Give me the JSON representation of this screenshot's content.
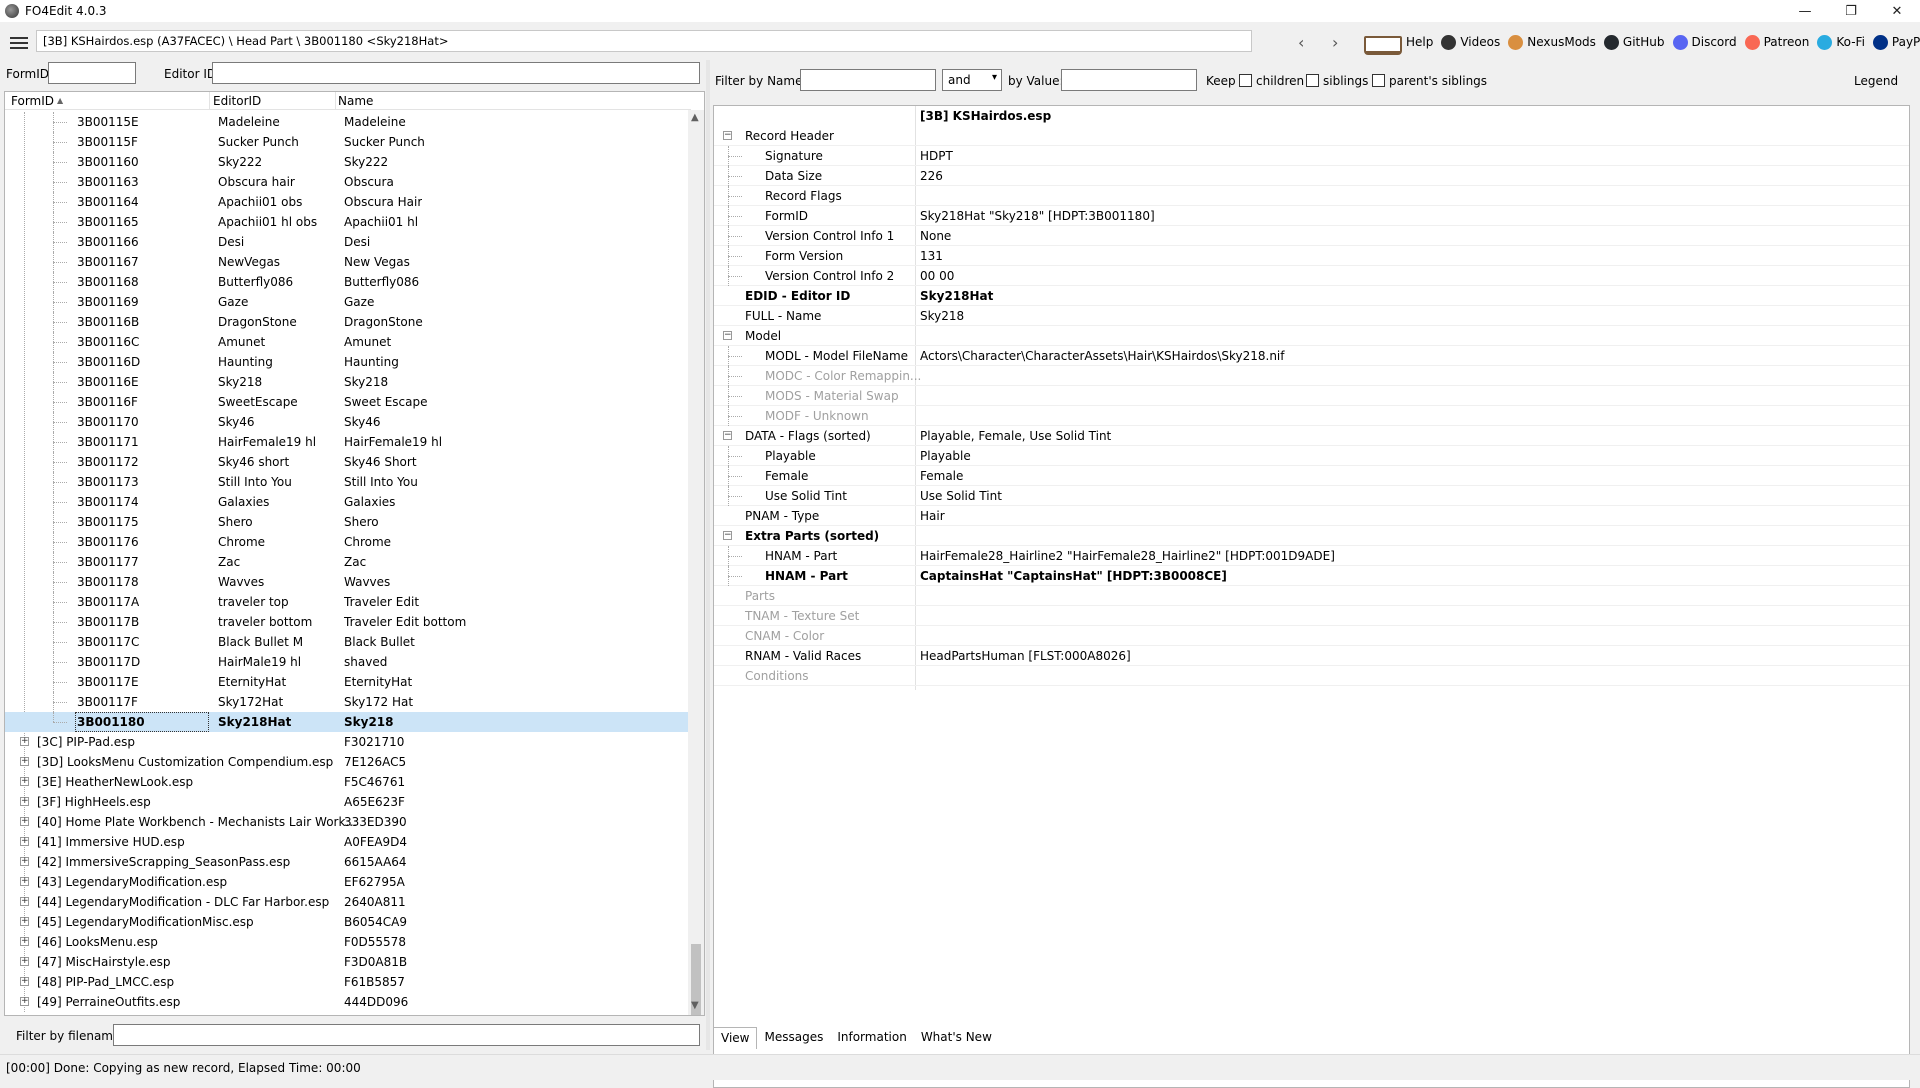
{
  "window": {
    "title": "FO4Edit 4.0.3",
    "controls": [
      "—",
      "❐",
      "✕"
    ]
  },
  "toolbar": {
    "path": "[3B] KSHairdos.esp (A37FACEC) \\ Head Part \\ 3B001180 <Sky218Hat>",
    "back": "‹",
    "forward": "›",
    "links": [
      {
        "label": "Help",
        "icon": "book-icon",
        "color": "#7a5a3a"
      },
      {
        "label": "Videos",
        "icon": "videos-icon",
        "color": "#333333"
      },
      {
        "label": "NexusMods",
        "icon": "nexusmods-icon",
        "color": "#d98f40"
      },
      {
        "label": "GitHub",
        "icon": "github-icon",
        "color": "#24292e"
      },
      {
        "label": "Discord",
        "icon": "discord-icon",
        "color": "#5865f2"
      },
      {
        "label": "Patreon",
        "icon": "patreon-icon",
        "color": "#f96854"
      },
      {
        "label": "Ko-Fi",
        "icon": "kofi-icon",
        "color": "#29abe0"
      },
      {
        "label": "PayPal",
        "icon": "paypal-icon",
        "color": "#003087"
      }
    ]
  },
  "left_filter": {
    "formid_label": "FormID",
    "editorid_label": "Editor ID",
    "formid_value": "",
    "editorid_value": ""
  },
  "tree": {
    "columns": [
      "FormID",
      "EditorID",
      "Name"
    ],
    "sort_indicator": "▲",
    "records": [
      {
        "formid": "3B00115E",
        "editorid": "Madeleine",
        "name": "Madeleine"
      },
      {
        "formid": "3B00115F",
        "editorid": "Sucker Punch",
        "name": "Sucker Punch"
      },
      {
        "formid": "3B001160",
        "editorid": "Sky222",
        "name": "Sky222"
      },
      {
        "formid": "3B001163",
        "editorid": "Obscura hair",
        "name": "Obscura"
      },
      {
        "formid": "3B001164",
        "editorid": "Apachii01 obs",
        "name": "Obscura Hair"
      },
      {
        "formid": "3B001165",
        "editorid": "Apachii01 hl obs",
        "name": "Apachii01 hl"
      },
      {
        "formid": "3B001166",
        "editorid": "Desi",
        "name": "Desi"
      },
      {
        "formid": "3B001167",
        "editorid": "NewVegas",
        "name": "New Vegas"
      },
      {
        "formid": "3B001168",
        "editorid": "Butterfly086",
        "name": "Butterfly086"
      },
      {
        "formid": "3B001169",
        "editorid": "Gaze",
        "name": "Gaze"
      },
      {
        "formid": "3B00116B",
        "editorid": "DragonStone",
        "name": "DragonStone"
      },
      {
        "formid": "3B00116C",
        "editorid": "Amunet",
        "name": "Amunet"
      },
      {
        "formid": "3B00116D",
        "editorid": "Haunting",
        "name": "Haunting"
      },
      {
        "formid": "3B00116E",
        "editorid": "Sky218",
        "name": "Sky218"
      },
      {
        "formid": "3B00116F",
        "editorid": "SweetEscape",
        "name": "Sweet Escape"
      },
      {
        "formid": "3B001170",
        "editorid": "Sky46",
        "name": "Sky46"
      },
      {
        "formid": "3B001171",
        "editorid": "HairFemale19 hl",
        "name": "HairFemale19 hl"
      },
      {
        "formid": "3B001172",
        "editorid": "Sky46 short",
        "name": "Sky46 Short"
      },
      {
        "formid": "3B001173",
        "editorid": "Still Into You",
        "name": "Still Into You"
      },
      {
        "formid": "3B001174",
        "editorid": "Galaxies",
        "name": "Galaxies"
      },
      {
        "formid": "3B001175",
        "editorid": "Shero",
        "name": "Shero"
      },
      {
        "formid": "3B001176",
        "editorid": "Chrome",
        "name": "Chrome"
      },
      {
        "formid": "3B001177",
        "editorid": "Zac",
        "name": "Zac"
      },
      {
        "formid": "3B001178",
        "editorid": "Wavves",
        "name": "Wavves"
      },
      {
        "formid": "3B00117A",
        "editorid": "traveler top",
        "name": "Traveler Edit"
      },
      {
        "formid": "3B00117B",
        "editorid": "traveler bottom",
        "name": "Traveler Edit bottom"
      },
      {
        "formid": "3B00117C",
        "editorid": "Black Bullet M",
        "name": "Black Bullet"
      },
      {
        "formid": "3B00117D",
        "editorid": "HairMale19 hl",
        "name": "shaved"
      },
      {
        "formid": "3B00117E",
        "editorid": "EternityHat",
        "name": "EternityHat"
      },
      {
        "formid": "3B00117F",
        "editorid": "Sky172Hat",
        "name": "Sky172 Hat"
      },
      {
        "formid": "3B001180",
        "editorid": "Sky218Hat",
        "name": "Sky218",
        "selected": true
      }
    ],
    "plugins": [
      {
        "name": "[3C] PIP-Pad.esp",
        "crc": "F3021710"
      },
      {
        "name": "[3D] LooksMenu Customization Compendium.esp",
        "crc": "7E126AC5"
      },
      {
        "name": "[3E] HeatherNewLook.esp",
        "crc": "F5C46761"
      },
      {
        "name": "[3F] HighHeels.esp",
        "crc": "A65E623F"
      },
      {
        "name": "[40] Home Plate Workbench - Mechanists Lair Work...",
        "crc": "333ED390"
      },
      {
        "name": "[41] Immersive HUD.esp",
        "crc": "A0FEA9D4"
      },
      {
        "name": "[42] ImmersiveScrapping_SeasonPass.esp",
        "crc": "6615AA64"
      },
      {
        "name": "[43] LegendaryModification.esp",
        "crc": "EF62795A"
      },
      {
        "name": "[44] LegendaryModification - DLC Far Harbor.esp",
        "crc": "2640A811"
      },
      {
        "name": "[45] LegendaryModificationMisc.esp",
        "crc": "B6054CA9"
      },
      {
        "name": "[46] LooksMenu.esp",
        "crc": "F0D55578"
      },
      {
        "name": "[47] MiscHairstyle.esp",
        "crc": "F3D0A81B"
      },
      {
        "name": "[48] PIP-Pad_LMCC.esp",
        "crc": "F61B5857"
      },
      {
        "name": "[49] PerraineOutfits.esp",
        "crc": "444DD096"
      }
    ]
  },
  "file_filter": {
    "label": "Filter by filename:",
    "value": ""
  },
  "right_filter": {
    "by_name_label": "Filter by Name:",
    "name_value": "",
    "operator": "and",
    "by_value_label": "by Value:",
    "value_value": "",
    "keep_label": "Keep",
    "children_label": "children",
    "siblings_label": "siblings",
    "parents_siblings_label": "parent's siblings",
    "legend_label": "Legend"
  },
  "record_view": {
    "file_header": "[3B] KSHairdos.esp",
    "rows": [
      {
        "key": "Record Header",
        "value": "",
        "level": 0,
        "expander": true
      },
      {
        "key": "Signature",
        "value": "HDPT",
        "level": 1
      },
      {
        "key": "Data Size",
        "value": "226",
        "level": 1
      },
      {
        "key": "Record Flags",
        "value": "",
        "level": 1
      },
      {
        "key": "FormID",
        "value": "Sky218Hat \"Sky218\" [HDPT:3B001180]",
        "level": 1
      },
      {
        "key": "Version Control Info 1",
        "value": "None",
        "level": 1
      },
      {
        "key": "Form Version",
        "value": "131",
        "level": 1
      },
      {
        "key": "Version Control Info 2",
        "value": "00 00",
        "level": 1
      },
      {
        "key": "EDID - Editor ID",
        "value": "Sky218Hat",
        "level": 0,
        "bold": true
      },
      {
        "key": "FULL - Name",
        "value": "Sky218",
        "level": 0
      },
      {
        "key": "Model",
        "value": "",
        "level": 0,
        "expander": true
      },
      {
        "key": "MODL - Model FileName",
        "value": "Actors\\Character\\CharacterAssets\\Hair\\KSHairdos\\Sky218.nif",
        "level": 1
      },
      {
        "key": "MODC - Color Remappin...",
        "value": "",
        "level": 1,
        "dim": true
      },
      {
        "key": "MODS - Material Swap",
        "value": "",
        "level": 1,
        "dim": true
      },
      {
        "key": "MODF - Unknown",
        "value": "",
        "level": 1,
        "dim": true
      },
      {
        "key": "DATA - Flags (sorted)",
        "value": "Playable, Female, Use Solid Tint",
        "level": 0,
        "expander": true
      },
      {
        "key": "Playable",
        "value": "Playable",
        "level": 1
      },
      {
        "key": "Female",
        "value": "Female",
        "level": 1
      },
      {
        "key": "Use Solid Tint",
        "value": "Use Solid Tint",
        "level": 1
      },
      {
        "key": "PNAM - Type",
        "value": "Hair",
        "level": 0
      },
      {
        "key": "Extra Parts (sorted)",
        "value": "",
        "level": 0,
        "expander": true,
        "bold": true
      },
      {
        "key": "HNAM - Part",
        "value": "HairFemale28_Hairline2 \"HairFemale28_Hairline2\" [HDPT:001D9ADE]",
        "level": 1
      },
      {
        "key": "HNAM - Part",
        "value": "CaptainsHat \"CaptainsHat\" [HDPT:3B0008CE]",
        "level": 1,
        "bold": true
      },
      {
        "key": "Parts",
        "value": "",
        "level": 0,
        "dim": true
      },
      {
        "key": "TNAM - Texture Set",
        "value": "",
        "level": 0,
        "dim": true
      },
      {
        "key": "CNAM - Color",
        "value": "",
        "level": 0,
        "dim": true
      },
      {
        "key": "RNAM - Valid Races",
        "value": "HeadPartsHuman [FLST:000A8026]",
        "level": 0
      },
      {
        "key": "Conditions",
        "value": "",
        "level": 0,
        "dim": true
      }
    ]
  },
  "tabs": [
    {
      "label": "View",
      "active": true
    },
    {
      "label": "Messages"
    },
    {
      "label": "Information"
    },
    {
      "label": "What's New"
    }
  ],
  "status": "[00:00] Done: Copying as new record, Elapsed Time: 00:00"
}
